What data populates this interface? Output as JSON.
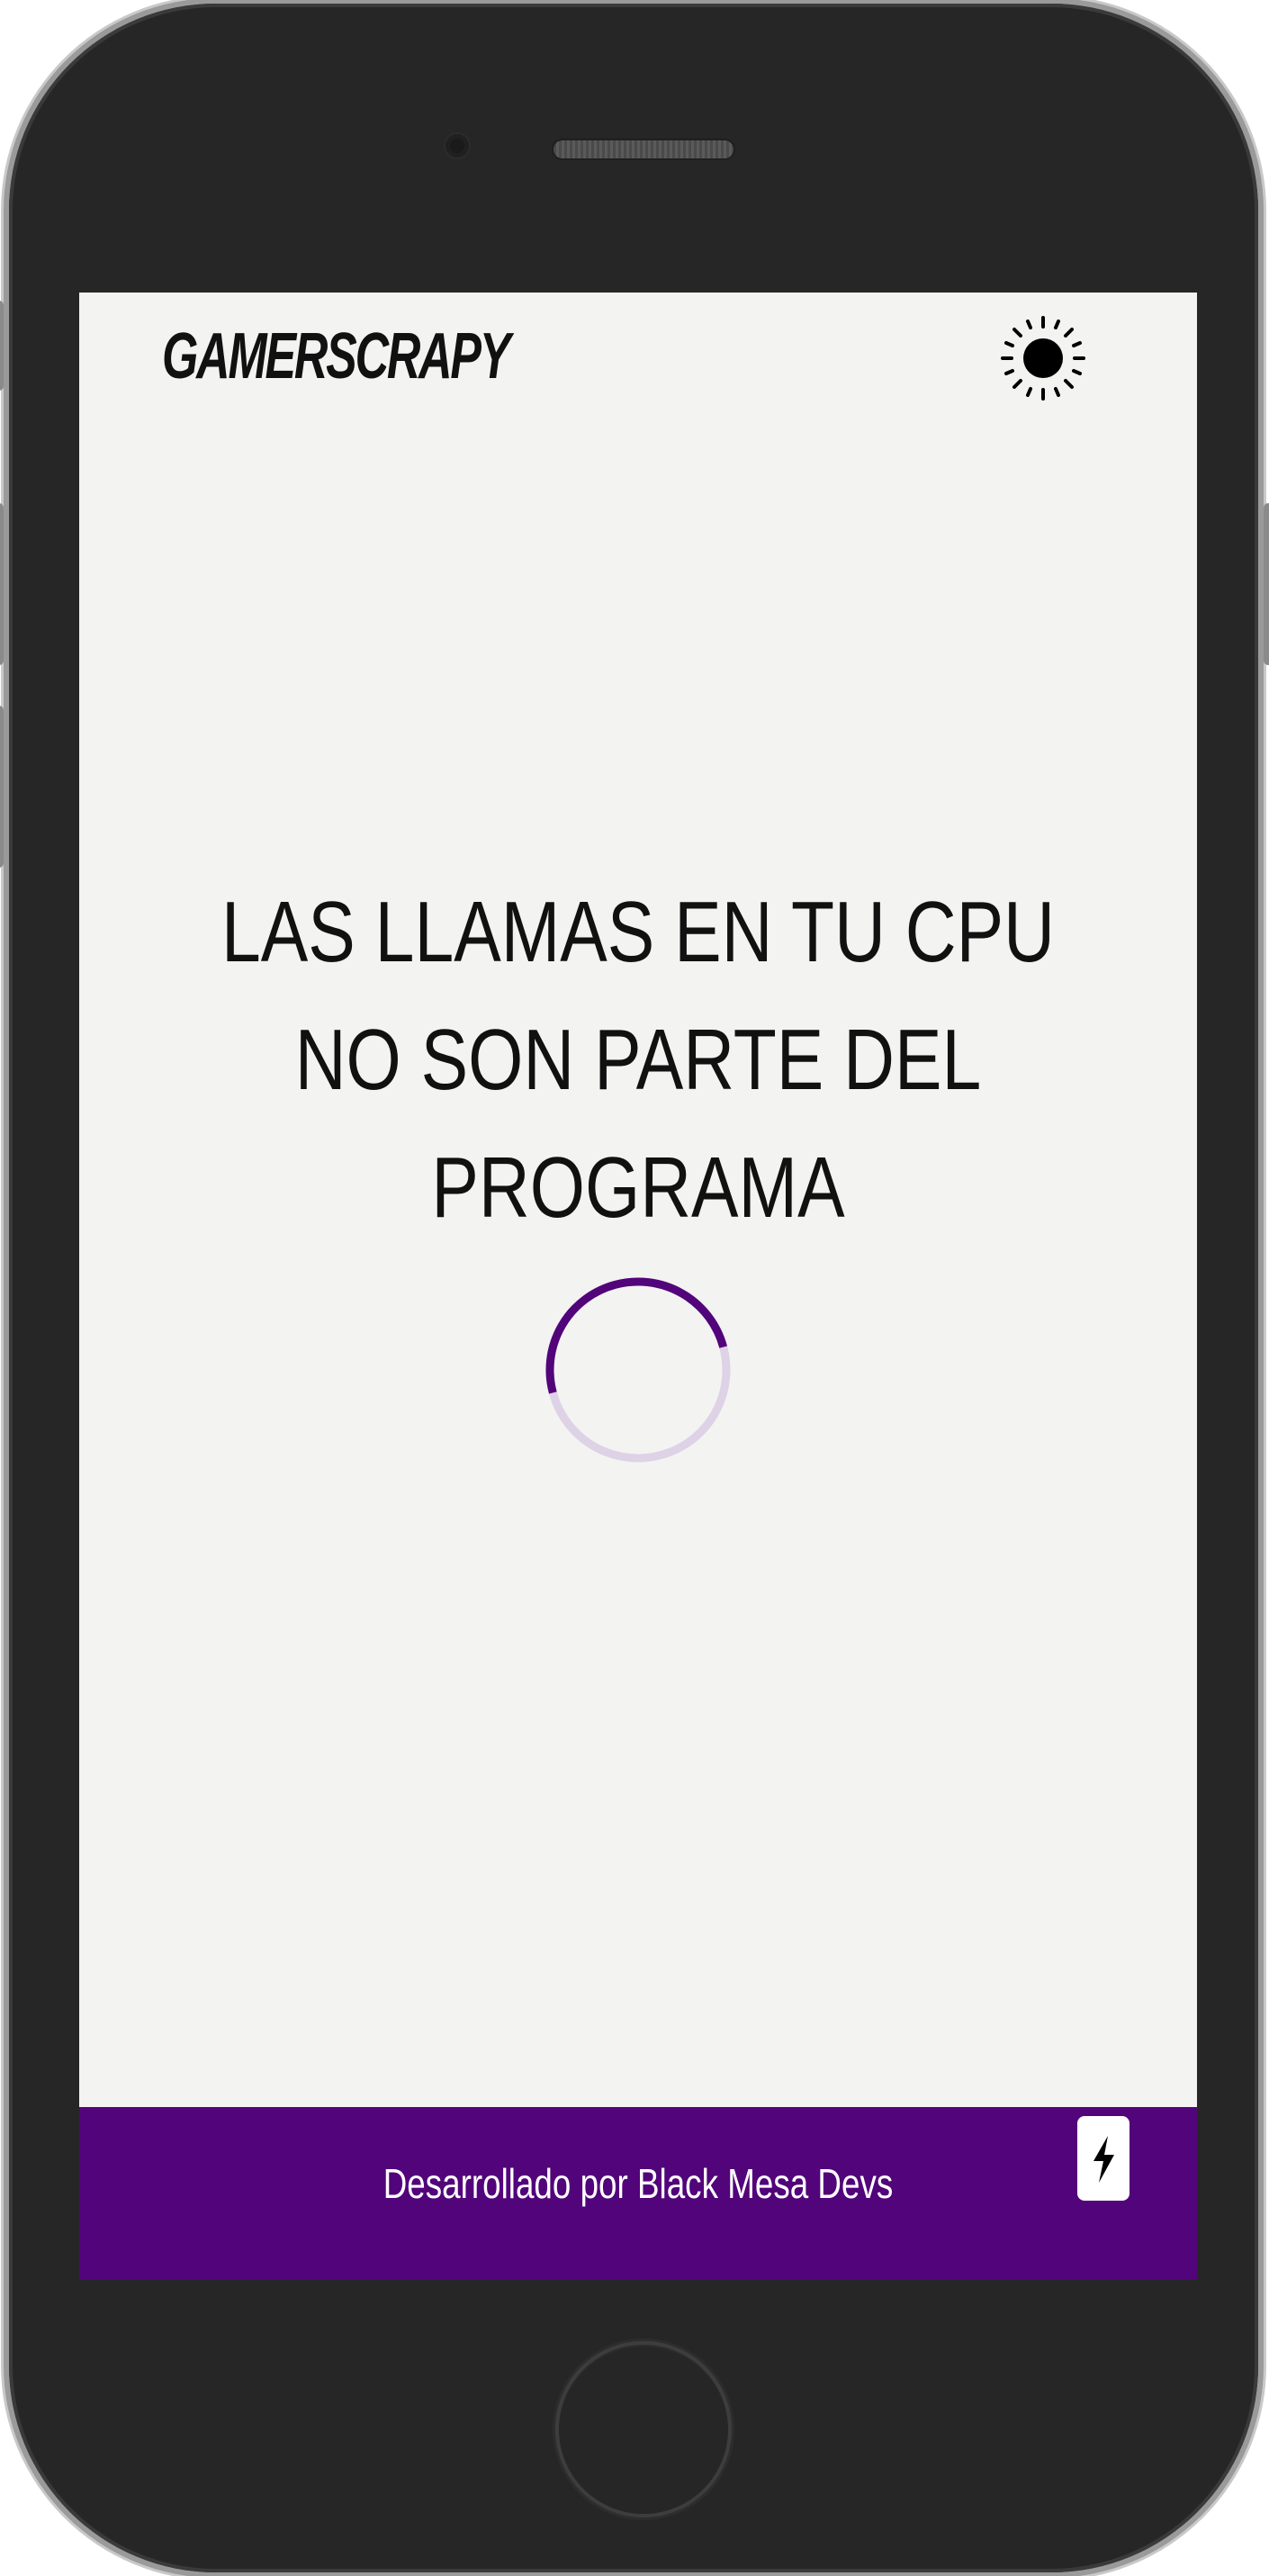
{
  "header": {
    "brand": "GAMERSCRAPY",
    "theme_toggle_icon": "sun-icon"
  },
  "main": {
    "message_lines": [
      "LAS LLAMAS EN TU CPU",
      "NO SON PARTE DEL",
      "PROGRAMA"
    ],
    "loading_icon": "spinner-icon"
  },
  "footer": {
    "credit": "Desarrollado por Black Mesa Devs",
    "action_icon": "lightning-icon"
  },
  "colors": {
    "accent": "#52047a",
    "background": "#f3f3f2",
    "text": "#111111"
  }
}
